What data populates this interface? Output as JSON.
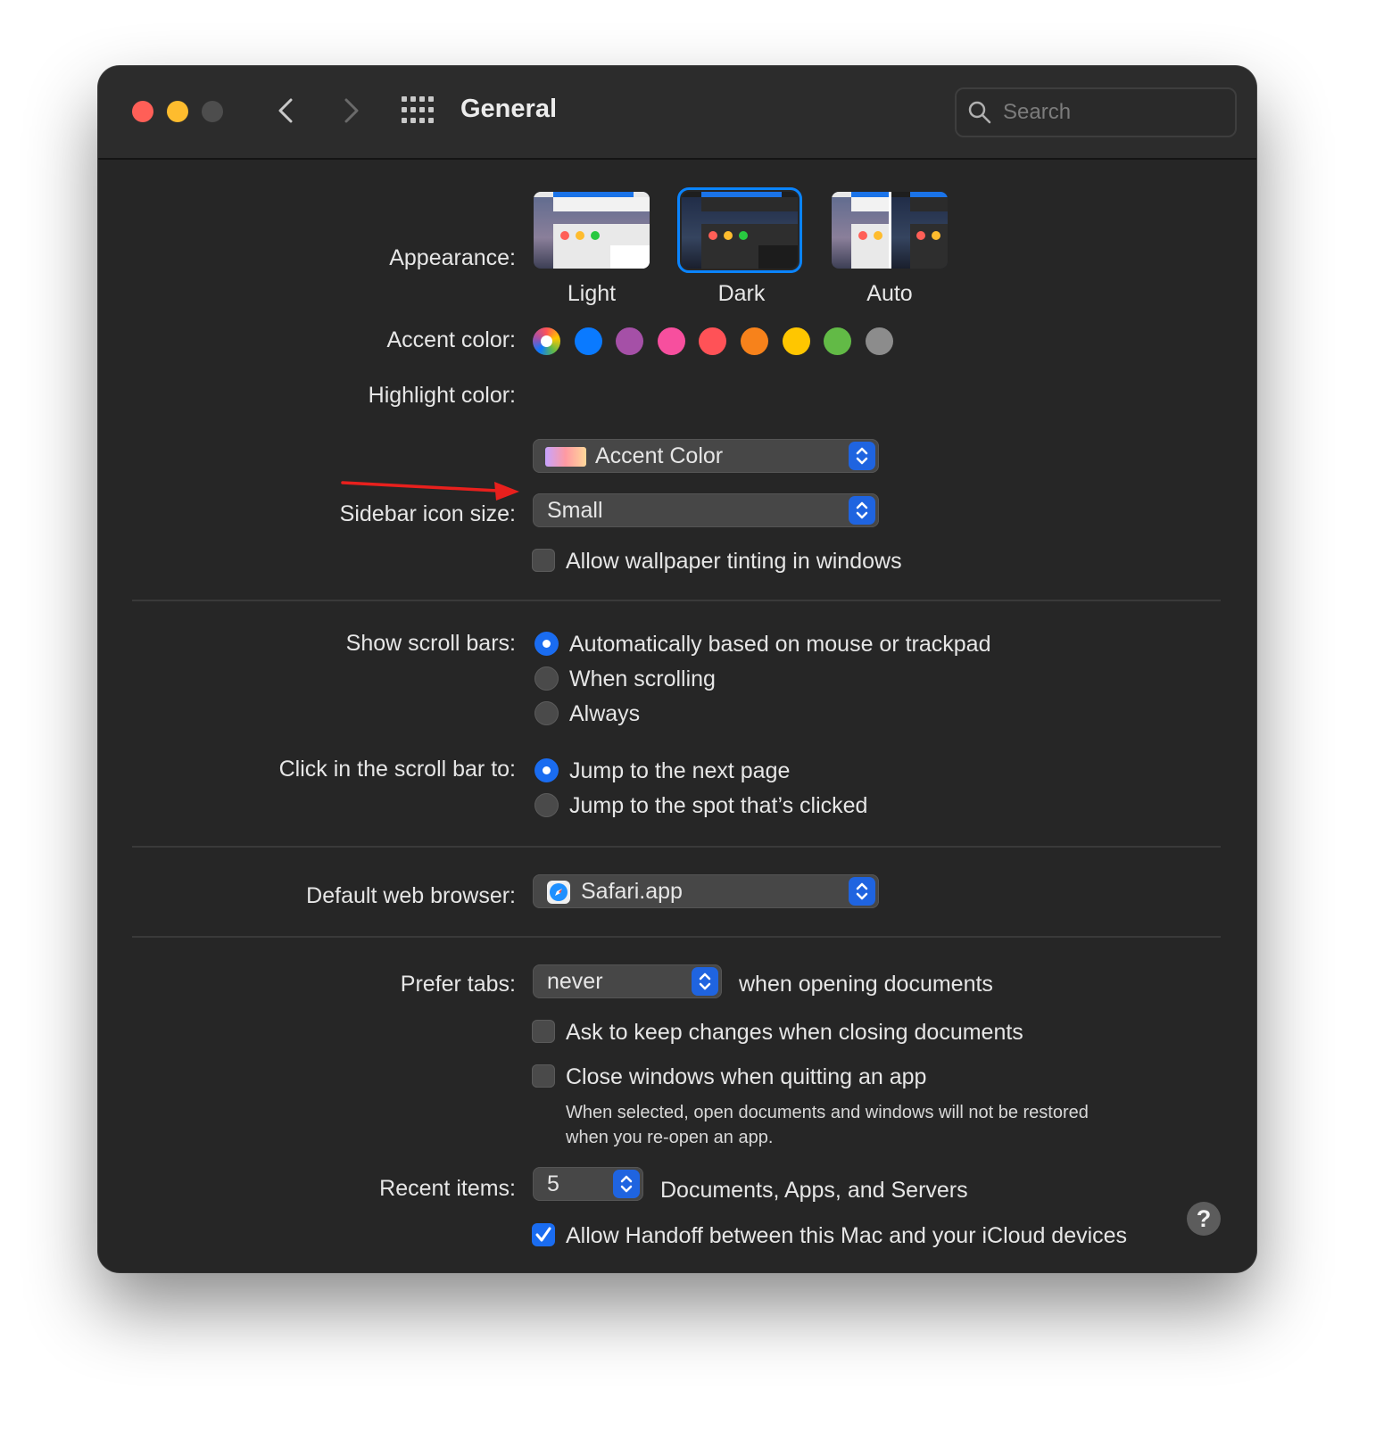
{
  "window": {
    "title": "General",
    "search_placeholder": "Search"
  },
  "appearance": {
    "label": "Appearance:",
    "options": [
      {
        "label": "Light",
        "selected": false
      },
      {
        "label": "Dark",
        "selected": true
      },
      {
        "label": "Auto",
        "selected": false
      }
    ]
  },
  "accent": {
    "label": "Accent color:",
    "colors": [
      "multicolor",
      "#0a7aff",
      "#a550a7",
      "#f74f9e",
      "#ff5257",
      "#f7821b",
      "#ffc600",
      "#62ba46",
      "#8c8c8c"
    ]
  },
  "highlight": {
    "label": "Highlight color:",
    "value": "Accent Color"
  },
  "sidebar_icon_size": {
    "label": "Sidebar icon size:",
    "value": "Small"
  },
  "wallpaper_tinting": {
    "label": "Allow wallpaper tinting in windows",
    "checked": false
  },
  "scroll_bars": {
    "label": "Show scroll bars:",
    "options": [
      {
        "label": "Automatically based on mouse or trackpad",
        "selected": true
      },
      {
        "label": "When scrolling",
        "selected": false
      },
      {
        "label": "Always",
        "selected": false
      }
    ]
  },
  "scroll_click": {
    "label": "Click in the scroll bar to:",
    "options": [
      {
        "label": "Jump to the next page",
        "selected": true
      },
      {
        "label": "Jump to the spot that’s clicked",
        "selected": false
      }
    ]
  },
  "browser": {
    "label": "Default web browser:",
    "value": "Safari.app"
  },
  "prefer_tabs": {
    "label": "Prefer tabs:",
    "value": "never",
    "suffix": "when opening documents"
  },
  "ask_keep_changes": {
    "label": "Ask to keep changes when closing documents",
    "checked": false
  },
  "close_windows": {
    "label": "Close windows when quitting an app",
    "checked": false,
    "note_line1": "When selected, open documents and windows will not be restored",
    "note_line2": "when you re-open an app."
  },
  "recent_items": {
    "label": "Recent items:",
    "value": "5",
    "suffix": "Documents, Apps, and Servers"
  },
  "handoff": {
    "label": "Allow Handoff between this Mac and your iCloud devices",
    "checked": true
  },
  "help": {
    "label": "?"
  }
}
